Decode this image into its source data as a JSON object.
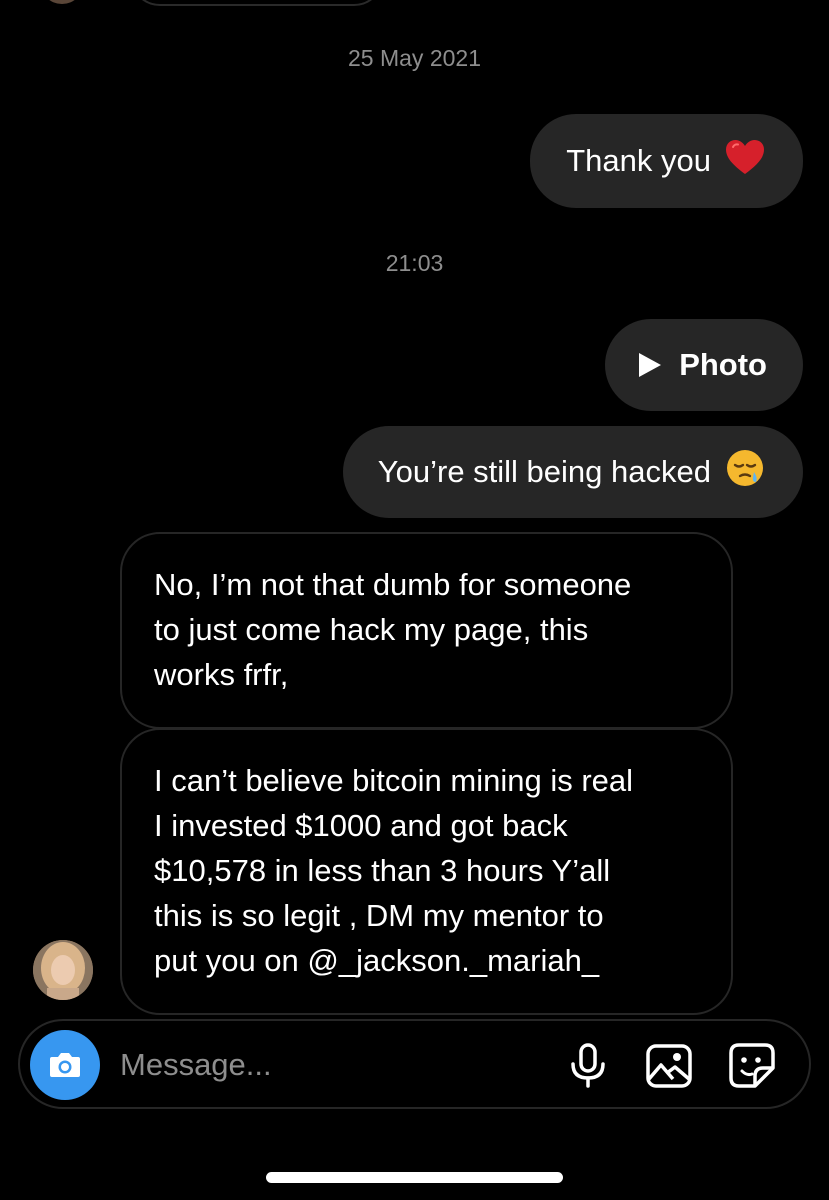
{
  "conversation": {
    "date_separator": "25 May 2021",
    "time_separator": "21:03",
    "messages": [
      {
        "direction": "outgoing",
        "text": "Thank you",
        "emoji": "❤️"
      },
      {
        "direction": "outgoing",
        "type": "photo",
        "text": "Photo"
      },
      {
        "direction": "outgoing",
        "text": "You’re still being hacked",
        "emoji": "😪"
      },
      {
        "direction": "incoming",
        "lines": [
          "No, I’m not that dumb for someone",
          "to just come hack my page, this",
          "works frfr,"
        ]
      },
      {
        "direction": "incoming",
        "lines": [
          "I can’t believe bitcoin mining is real",
          "I invested $1000 and got back",
          "$10,578 in less than 3 hours Y’all",
          "this is so legit , DM my mentor to",
          "put you on @_jackson._mariah_"
        ]
      }
    ]
  },
  "composer": {
    "placeholder": "Message...",
    "icons": [
      "camera-icon",
      "microphone-icon",
      "gallery-icon",
      "sticker-icon"
    ],
    "camera_color": "#3797f0"
  },
  "colors": {
    "background": "#000000",
    "bubble_outgoing": "#262626",
    "bubble_incoming_border": "#262626",
    "timestamp": "#8e8e8e"
  }
}
